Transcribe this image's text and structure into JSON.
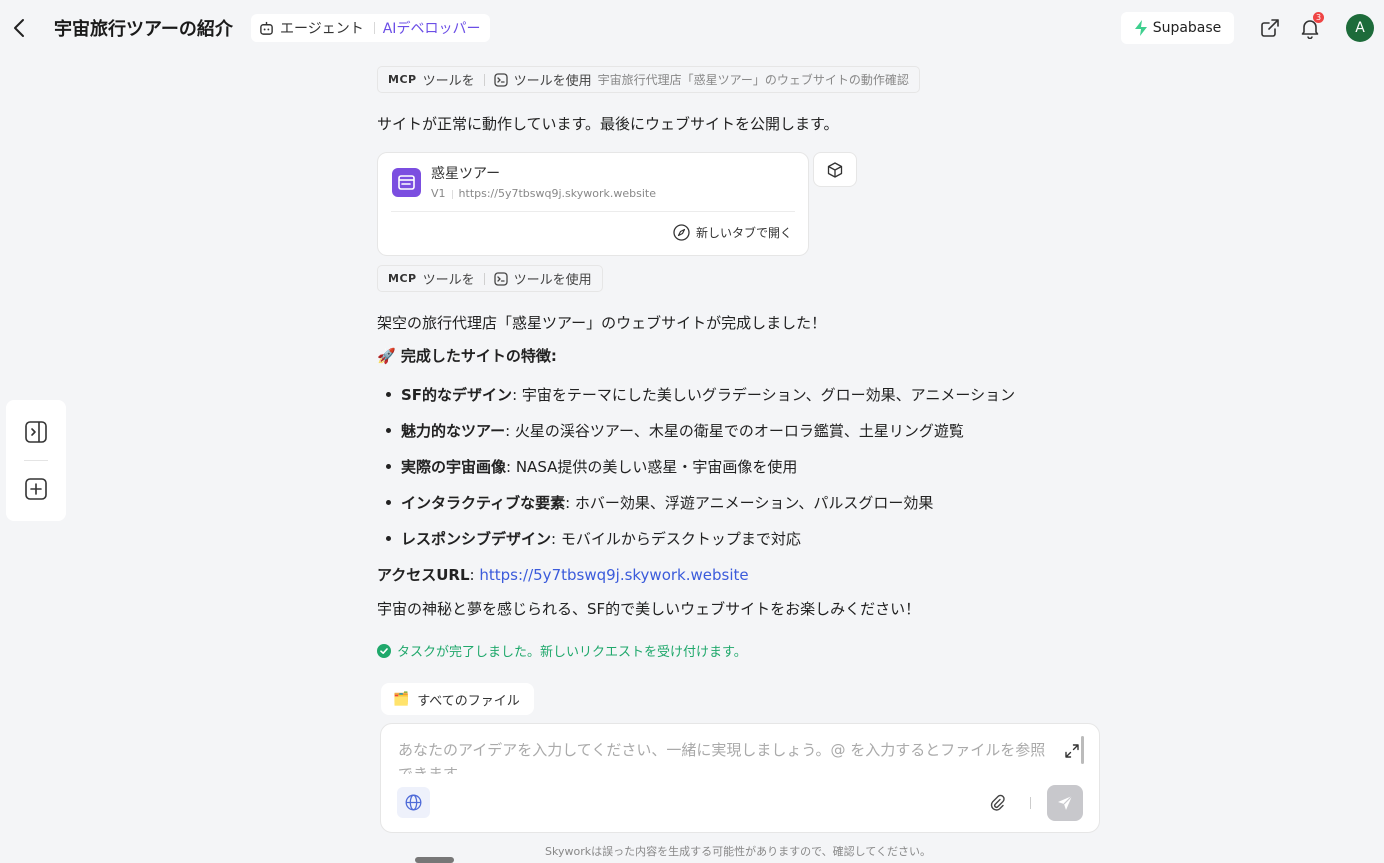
{
  "header": {
    "title": "宇宙旅行ツアーの紹介",
    "agent_label": "エージェント",
    "agent_role": "AIデベロッパー",
    "supabase_label": "Supabase",
    "notification_count": "3",
    "avatar_letter": "A"
  },
  "messages": {
    "tool_chip_1": {
      "mcp": "MCP",
      "tool": "ツールを",
      "use": "ツールを使用",
      "desc": "宇宙旅行代理店「惑星ツアー」のウェブサイトの動作確認"
    },
    "status_text": "サイトが正常に動作しています。最後にウェブサイトを公開します。",
    "site_card": {
      "name": "惑星ツアー",
      "version": "V1",
      "url": "https://5y7tbswq9j.skywork.website",
      "open_tab_label": "新しいタブで開く"
    },
    "tool_chip_2": {
      "mcp": "MCP",
      "tool": "ツールを",
      "use": "ツールを使用"
    },
    "complete_text": "架空の旅行代理店「惑星ツアー」のウェブサイトが完成しました！",
    "features_title": "🚀 完成したサイトの特徴:",
    "features": [
      {
        "label": "SF的なデザイン",
        "text": ": 宇宙をテーマにした美しいグラデーション、グロー効果、アニメーション"
      },
      {
        "label": "魅力的なツアー",
        "text": ": 火星の渓谷ツアー、木星の衛星でのオーロラ鑑賞、土星リング遊覧"
      },
      {
        "label": "実際の宇宙画像",
        "text": ": NASA提供の美しい惑星・宇宙画像を使用"
      },
      {
        "label": "インタラクティブな要素",
        "text": ": ホバー効果、浮遊アニメーション、パルスグロー効果"
      },
      {
        "label": "レスポンシブデザイン",
        "text": ": モバイルからデスクトップまで対応"
      }
    ],
    "access_label": "アクセスURL",
    "access_url": "https://5y7tbswq9j.skywork.website",
    "closing_text": "宇宙の神秘と夢を感じられる、SF的で美しいウェブサイトをお楽しみください！",
    "task_done": "タスクが完了しました。新しいリクエストを受け付けます。"
  },
  "files_chip": {
    "icon": "🗂️",
    "label": "すべてのファイル"
  },
  "input": {
    "placeholder": "あなたのアイデアを入力してください、一緒に実現しましょう。@ を入力するとファイルを参照できます"
  },
  "footer": {
    "disclaimer": "Skyworkは誤った内容を生成する可能性がありますので、確認してください。"
  },
  "colors": {
    "accent": "#6b4ee6",
    "link": "#3b5bdb",
    "success": "#1fa86b",
    "supabase": "#3ecf8e"
  }
}
